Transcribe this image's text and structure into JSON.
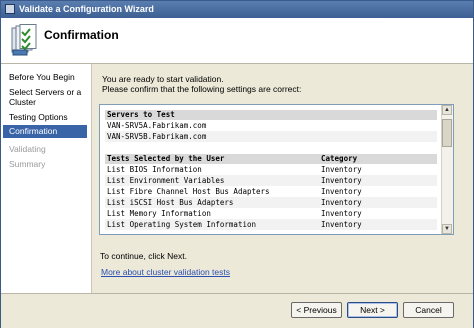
{
  "window": {
    "title": "Validate a Configuration Wizard"
  },
  "header": {
    "title": "Confirmation",
    "icon": "wizard-checklist-icon"
  },
  "nav": {
    "items": [
      {
        "label": "Before You Begin",
        "state": "normal"
      },
      {
        "label": "Select Servers or a Cluster",
        "state": "normal"
      },
      {
        "label": "Testing Options",
        "state": "normal"
      },
      {
        "label": "Confirmation",
        "state": "active"
      },
      {
        "label": "Validating",
        "state": "disabled"
      },
      {
        "label": "Summary",
        "state": "disabled"
      }
    ]
  },
  "content": {
    "intro_line1": "You are ready to start validation.",
    "intro_line2": "Please confirm that the following settings are correct:",
    "servers_header": "Servers to Test",
    "servers": [
      "VAN-SRV5A.Fabrikam.com",
      "VAN-SRV5B.Fabrikam.com"
    ],
    "tests_header": "Tests Selected by the User",
    "category_header": "Category",
    "tests": [
      {
        "name": "List BIOS Information",
        "category": "Inventory"
      },
      {
        "name": "List Environment Variables",
        "category": "Inventory"
      },
      {
        "name": "List Fibre Channel Host Bus Adapters",
        "category": "Inventory"
      },
      {
        "name": "List iSCSI Host Bus Adapters",
        "category": "Inventory"
      },
      {
        "name": "List Memory Information",
        "category": "Inventory"
      },
      {
        "name": "List Operating System Information",
        "category": "Inventory"
      }
    ],
    "continue_text": "To continue, click Next.",
    "link_text": "More about cluster validation tests"
  },
  "footer": {
    "previous_label": "< Previous",
    "next_label": "Next >",
    "cancel_label": "Cancel"
  }
}
